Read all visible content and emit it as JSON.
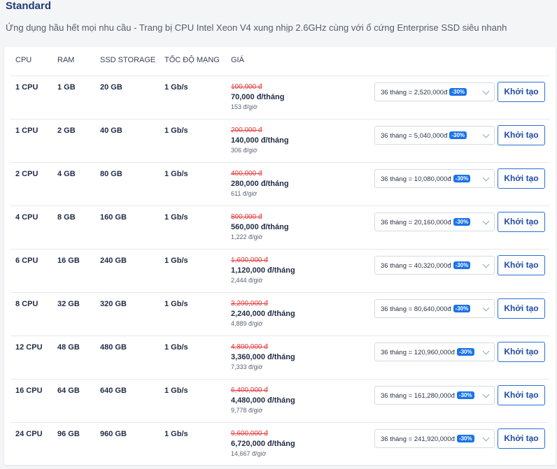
{
  "heading": "Standard",
  "description": "Ứng dụng hầu hết mọi nhu cầu - Trang bị CPU Intel Xeon V4 xung nhịp 2.6GHz cùng với ổ cứng Enterprise SSD siêu nhanh",
  "columns": {
    "cpu": "CPU",
    "ram": "RAM",
    "ssd": "SSD STORAGE",
    "network": "TỐC ĐỘ MẠNG",
    "price": "GIÁ"
  },
  "accent_color": "#1a73e8",
  "plans": [
    {
      "cpu": "1 CPU",
      "ram": "1 GB",
      "ssd": "20 GB",
      "network": "1 Gb/s",
      "old_price": "100,000 đ",
      "price": "70,000 đ/tháng",
      "hourly": "153 đ/giờ",
      "term": "36 tháng = 2,520,000đ",
      "discount": "-30%",
      "button": "Khởi tạo"
    },
    {
      "cpu": "1 CPU",
      "ram": "2 GB",
      "ssd": "40 GB",
      "network": "1 Gb/s",
      "old_price": "200,000 đ",
      "price": "140,000 đ/tháng",
      "hourly": "306 đ/giờ",
      "term": "36 tháng = 5,040,000đ",
      "discount": "-30%",
      "button": "Khởi tạo"
    },
    {
      "cpu": "2 CPU",
      "ram": "4 GB",
      "ssd": "80 GB",
      "network": "1 Gb/s",
      "old_price": "400,000 đ",
      "price": "280,000 đ/tháng",
      "hourly": "611 đ/giờ",
      "term": "36 tháng = 10,080,000đ",
      "discount": "-30%",
      "button": "Khởi tạo"
    },
    {
      "cpu": "4 CPU",
      "ram": "8 GB",
      "ssd": "160 GB",
      "network": "1 Gb/s",
      "old_price": "800,000 đ",
      "price": "560,000 đ/tháng",
      "hourly": "1,222 đ/giờ",
      "term": "36 tháng = 20,160,000đ",
      "discount": "-30%",
      "button": "Khởi tạo"
    },
    {
      "cpu": "6 CPU",
      "ram": "16 GB",
      "ssd": "240 GB",
      "network": "1 Gb/s",
      "old_price": "1,600,000 đ",
      "price": "1,120,000 đ/tháng",
      "hourly": "2,444 đ/giờ",
      "term": "36 tháng = 40,320,000đ",
      "discount": "-30%",
      "button": "Khởi tạo"
    },
    {
      "cpu": "8 CPU",
      "ram": "32 GB",
      "ssd": "320 GB",
      "network": "1 Gb/s",
      "old_price": "3,200,000 đ",
      "price": "2,240,000 đ/tháng",
      "hourly": "4,889 đ/giờ",
      "term": "36 tháng = 80,640,000đ",
      "discount": "-30%",
      "button": "Khởi tạo"
    },
    {
      "cpu": "12 CPU",
      "ram": "48 GB",
      "ssd": "480 GB",
      "network": "1 Gb/s",
      "old_price": "4,800,000 đ",
      "price": "3,360,000 đ/tháng",
      "hourly": "7,333 đ/giờ",
      "term": "36 tháng = 120,960,000đ",
      "discount": "-30%",
      "button": "Khởi tạo"
    },
    {
      "cpu": "16 CPU",
      "ram": "64 GB",
      "ssd": "640 GB",
      "network": "1 Gb/s",
      "old_price": "6,400,000 đ",
      "price": "4,480,000 đ/tháng",
      "hourly": "9,778 đ/giờ",
      "term": "36 tháng = 161,280,000đ",
      "discount": "-30%",
      "button": "Khởi tạo"
    },
    {
      "cpu": "24 CPU",
      "ram": "96 GB",
      "ssd": "960 GB",
      "network": "1 Gb/s",
      "old_price": "9,600,000 đ",
      "price": "6,720,000 đ/tháng",
      "hourly": "14,667 đ/giờ",
      "term": "36 tháng = 241,920,000đ",
      "discount": "-30%",
      "button": "Khởi tạo"
    }
  ]
}
